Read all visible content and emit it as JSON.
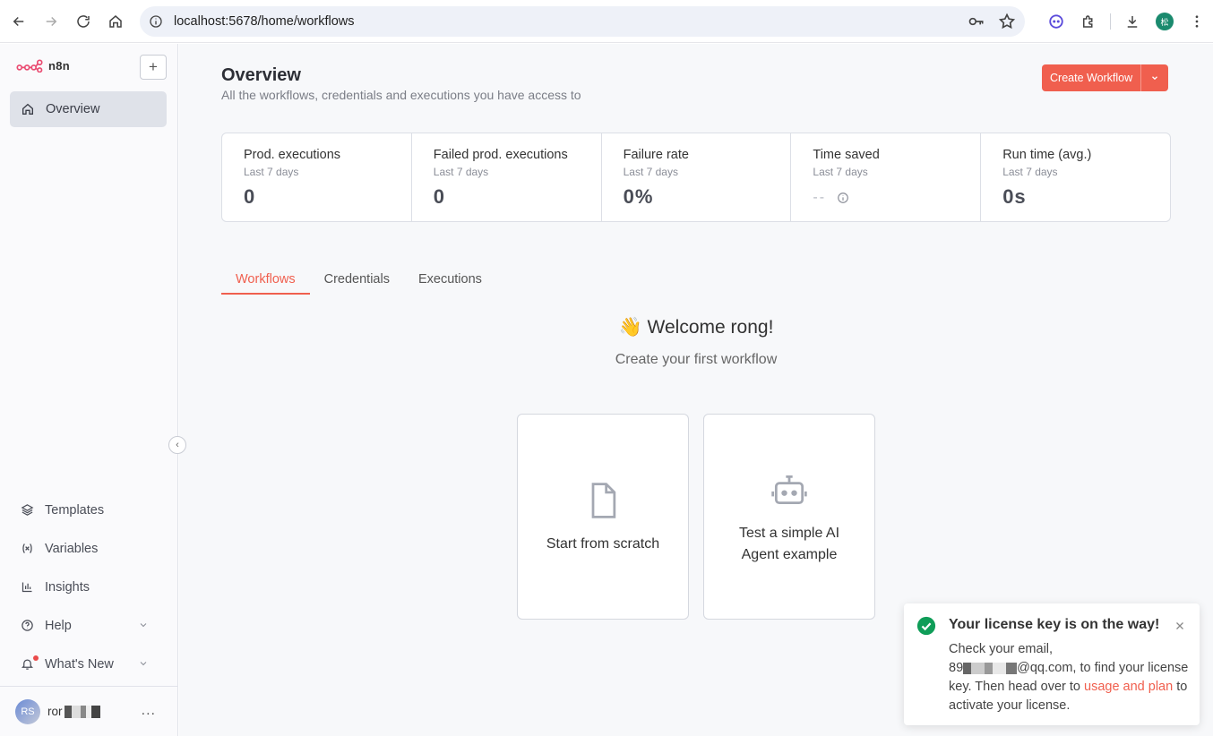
{
  "browser": {
    "url": "localhost:5678/home/workflows",
    "profile_initial": "松"
  },
  "sidebar": {
    "logo_text": "n8n",
    "new_button": "+",
    "active_item": "Overview",
    "items": [
      {
        "label": "Templates",
        "icon": "templates-icon"
      },
      {
        "label": "Variables",
        "icon": "variables-icon"
      },
      {
        "label": "Insights",
        "icon": "insights-icon"
      },
      {
        "label": "Help",
        "icon": "help-icon"
      },
      {
        "label": "What's New",
        "icon": "bell-icon"
      }
    ],
    "user": {
      "initials": "RS",
      "name": "ror"
    },
    "more": "..."
  },
  "header": {
    "title": "Overview",
    "subtitle": "All the workflows, credentials and executions you have access to",
    "create_button": "Create Workflow"
  },
  "stats": [
    {
      "title": "Prod. executions",
      "period": "Last 7 days",
      "value": "0"
    },
    {
      "title": "Failed prod. executions",
      "period": "Last 7 days",
      "value": "0"
    },
    {
      "title": "Failure rate",
      "period": "Last 7 days",
      "value": "0%"
    },
    {
      "title": "Time saved",
      "period": "Last 7 days",
      "value": "--"
    },
    {
      "title": "Run time (avg.)",
      "period": "Last 7 days",
      "value": "0s"
    }
  ],
  "tabs": [
    "Workflows",
    "Credentials",
    "Executions"
  ],
  "welcome": {
    "title": "👋 Welcome rong!",
    "subtitle": "Create your first workflow"
  },
  "cards": [
    {
      "label": "Start from scratch"
    },
    {
      "label_line1": "Test a simple AI",
      "label_line2": "Agent example"
    }
  ],
  "toast": {
    "title": "Your license key is on the way!",
    "body_1": "Check your email,",
    "email_prefix": "89",
    "email_suffix": "@qq.com, to find your license key. Then head over to ",
    "link": "usage and plan",
    "body_2": " to activate your license."
  },
  "colors": {
    "accent": "#f05f4e",
    "success": "#0f9d58"
  }
}
